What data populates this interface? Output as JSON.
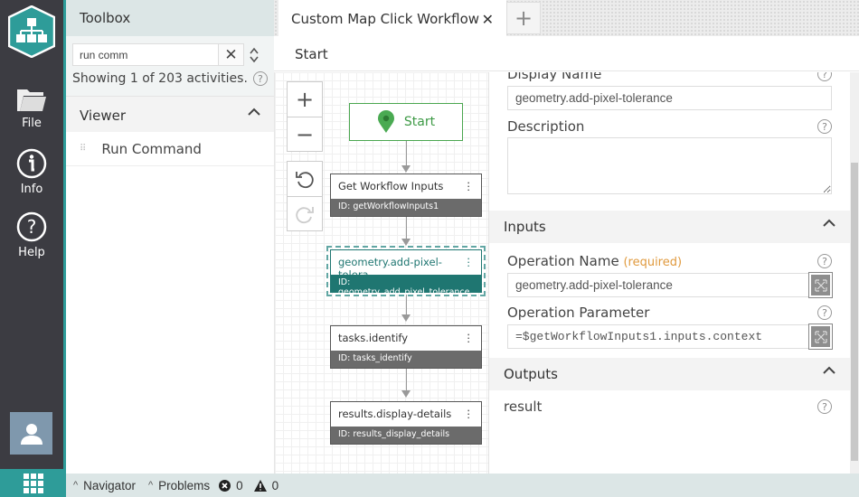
{
  "rail": {
    "items": [
      {
        "label": "File",
        "icon": "folder-icon"
      },
      {
        "label": "Info",
        "icon": "info-icon"
      },
      {
        "label": "Help",
        "icon": "help-icon"
      }
    ]
  },
  "toolbox": {
    "title": "Toolbox",
    "search_value": "run comm",
    "count_text": "Showing 1 of 203 activities.",
    "sections": [
      {
        "title": "Viewer",
        "items": [
          "Run Command"
        ]
      }
    ]
  },
  "tabs": [
    {
      "label": "Custom Map Click Workflow",
      "active": true
    }
  ],
  "breadcrumb": "Start",
  "canvas": {
    "start_label": "Start",
    "nodes": [
      {
        "title": "Get Workflow Inputs",
        "id": "ID: getWorkflowInputs1",
        "selected": false
      },
      {
        "title": "geometry.add-pixel-tolera...",
        "id": "ID: geometry_add_pixel_tolerance",
        "selected": true
      },
      {
        "title": "tasks.identify",
        "id": "ID: tasks_identify",
        "selected": false
      },
      {
        "title": "results.display-details",
        "id": "ID: results_display_details",
        "selected": false
      }
    ]
  },
  "properties": {
    "display_name_label": "Display Name",
    "display_name_value": "geometry.add-pixel-tolerance",
    "description_label": "Description",
    "description_value": "",
    "inputs_title": "Inputs",
    "inputs": [
      {
        "label": "Operation Name",
        "required": "(required)",
        "value": "geometry.add-pixel-tolerance",
        "mono": false
      },
      {
        "label": "Operation Parameter",
        "required": "",
        "value": "=$getWorkflowInputs1.inputs.context",
        "mono": true
      }
    ],
    "outputs_title": "Outputs",
    "outputs": [
      "result"
    ]
  },
  "statusbar": {
    "navigator": "Navigator",
    "problems": "Problems",
    "errors": "0",
    "warnings": "0"
  },
  "colors": {
    "accent": "#2e9c99",
    "selected_node": "#1f7671",
    "required": "#e09a3e",
    "start_green": "#3e9a46"
  }
}
